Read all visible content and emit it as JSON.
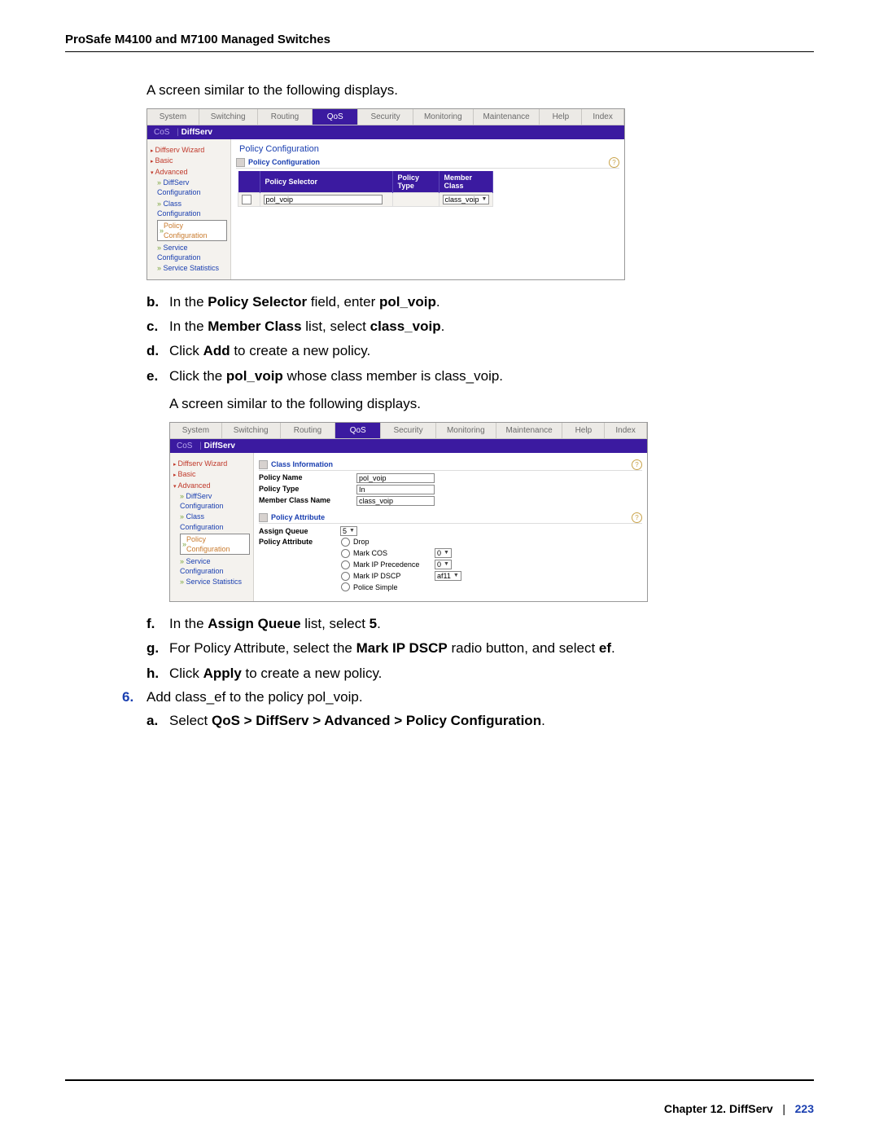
{
  "doc_header": "ProSafe M4100 and M7100 Managed Switches",
  "intro1": "A screen similar to the following displays.",
  "tabs": {
    "system": "System",
    "switching": "Switching",
    "routing": "Routing",
    "qos": "QoS",
    "security": "Security",
    "monitoring": "Monitoring",
    "maintenance": "Maintenance",
    "help": "Help",
    "index": "Index"
  },
  "subtabs": {
    "cos": "CoS",
    "diffserv": "DiffServ",
    "sep": "|"
  },
  "sidebar": {
    "wizard": "Diffserv Wizard",
    "basic": "Basic",
    "advanced": "Advanced",
    "diffserv_cfg": "DiffServ Configuration",
    "class_cfg": "Class Configuration",
    "policy_cfg": "Policy Configuration",
    "service_cfg": "Service Configuration",
    "service_stats": "Service Statistics"
  },
  "shot1": {
    "title": "Policy Configuration",
    "section": "Policy Configuration",
    "th1": "Policy Selector",
    "th2": "Policy Type",
    "th3": "Member Class",
    "input_val": "pol_voip",
    "select_val": "class_voip"
  },
  "steps1": {
    "b": {
      "m": "b.",
      "pre": "In the ",
      "b1": "Policy Selector",
      "mid": " field, enter ",
      "b2": "pol_voip",
      "post": "."
    },
    "c": {
      "m": "c.",
      "pre": "In the ",
      "b1": "Member Class",
      "mid": " list, select ",
      "b2": "class_voip",
      "post": "."
    },
    "d": {
      "m": "d.",
      "pre": "Click ",
      "b1": "Add",
      "post": " to create a new policy."
    },
    "e": {
      "m": "e.",
      "pre": "Click the ",
      "b1": "pol_voip",
      "post": " whose class member is class_voip."
    }
  },
  "intro2": "A screen similar to the following displays.",
  "shot2": {
    "title": "Class Information",
    "policy_name_k": "Policy Name",
    "policy_name_v": "pol_voip",
    "policy_type_k": "Policy Type",
    "policy_type_v": "In",
    "member_class_k": "Member Class Name",
    "member_class_v": "class_voip",
    "attr_section": "Policy Attribute",
    "assign_queue_k": "Assign Queue",
    "assign_queue_v": "5",
    "policy_attr_k": "Policy Attribute",
    "rows": {
      "drop": "Drop",
      "mark_cos": "Mark COS",
      "mark_ip_prec": "Mark IP Precedence",
      "mark_ip_dscp": "Mark IP DSCP",
      "police_simple": "Police Simple"
    },
    "vals": {
      "cos": "0",
      "ipprec": "0",
      "dscp": "af11"
    }
  },
  "steps2": {
    "f": {
      "m": "f.",
      "pre": "In the ",
      "b1": "Assign Queue",
      "mid": " list, select ",
      "b2": "5",
      "post": "."
    },
    "g": {
      "m": "g.",
      "pre": "For Policy Attribute, select the ",
      "b1": "Mark IP DSCP",
      "mid": " radio button, and select ",
      "b2": "ef",
      "post": "."
    },
    "h": {
      "m": "h.",
      "pre": " Click ",
      "b1": "Apply",
      "post": " to create a new policy."
    }
  },
  "step6": {
    "m": "6.",
    "text": "Add class_ef to the policy pol_voip."
  },
  "step6a": {
    "m": "a.",
    "pre": "Select ",
    "b1": "QoS > DiffServ > Advanced > Policy Configuration",
    "post": "."
  },
  "footer": {
    "chapter": "Chapter 12.  DiffServ",
    "sep": "|",
    "page": "223"
  }
}
